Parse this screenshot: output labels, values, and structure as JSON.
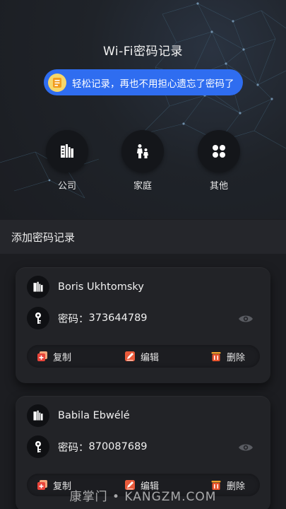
{
  "app": {
    "title": "Wi-Fi密码记录"
  },
  "banner": {
    "text": "轻松记录，再也不用担心遗忘了密码了",
    "icon": "note-icon"
  },
  "categories": [
    {
      "label": "公司",
      "icon": "building-icon"
    },
    {
      "label": "家庭",
      "icon": "family-icon"
    },
    {
      "label": "其他",
      "icon": "grid-icon"
    }
  ],
  "section": {
    "title": "添加密码记录"
  },
  "records": [
    {
      "name": "Boris Ukhtomsky",
      "password_label": "密码：",
      "password": "373644789"
    },
    {
      "name": "Babila Ebwélé",
      "password_label": "密码：",
      "password": "870087689"
    }
  ],
  "actions": {
    "copy": "复制",
    "edit": "编辑",
    "delete": "删除"
  },
  "watermark": "康掌门 • KANGZM.COM",
  "colors": {
    "accent": "#2f6df0",
    "background": "#1c1d21",
    "card": "#222327"
  }
}
